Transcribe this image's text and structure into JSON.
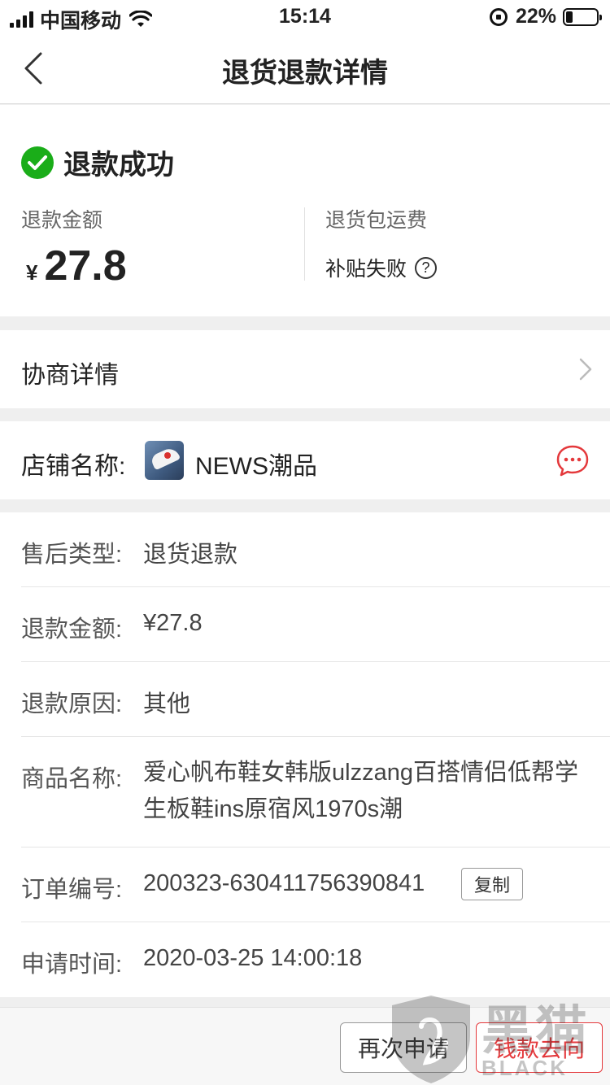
{
  "status_bar": {
    "carrier": "中国移动",
    "time": "15:14",
    "battery_percent": "22%",
    "battery_level": 0.22
  },
  "nav": {
    "title": "退货退款详情",
    "back_icon": "chevron-left-icon"
  },
  "refund_status": {
    "status_text": "退款成功",
    "status_icon": "check-circle-icon",
    "status_color": "#1aad19",
    "amount_label": "退款金额",
    "currency": "¥",
    "amount": "27.8",
    "shipping_label": "退货包运费",
    "shipping_value": "补贴失败",
    "help_icon": "question-circle-icon",
    "help_glyph": "?"
  },
  "negotiation": {
    "label": "协商详情"
  },
  "store": {
    "label": "店铺名称:",
    "name": "NEWS潮品",
    "chat_icon": "chat-bubble-icon",
    "accent_color": "#e4393c"
  },
  "details": [
    {
      "label": "售后类型:",
      "value": "退货退款"
    },
    {
      "label": "退款金额:",
      "value": "¥27.8"
    },
    {
      "label": "退款原因:",
      "value": "其他"
    },
    {
      "label": "商品名称:",
      "value": "爱心帆布鞋女韩版ulzzang百搭情侣低帮学生板鞋ins原宿风1970s潮"
    },
    {
      "label": "订单编号:",
      "value": "200323-630411756390841",
      "action": "复制"
    },
    {
      "label": "申请时间:",
      "value": "2020-03-25 14:00:18"
    }
  ],
  "bottom_bar": {
    "reapply_label": "再次申请",
    "money_whereabouts_label": "钱款去向"
  },
  "watermark": {
    "logo": "黑猫",
    "sub": "BLACK CAT"
  }
}
